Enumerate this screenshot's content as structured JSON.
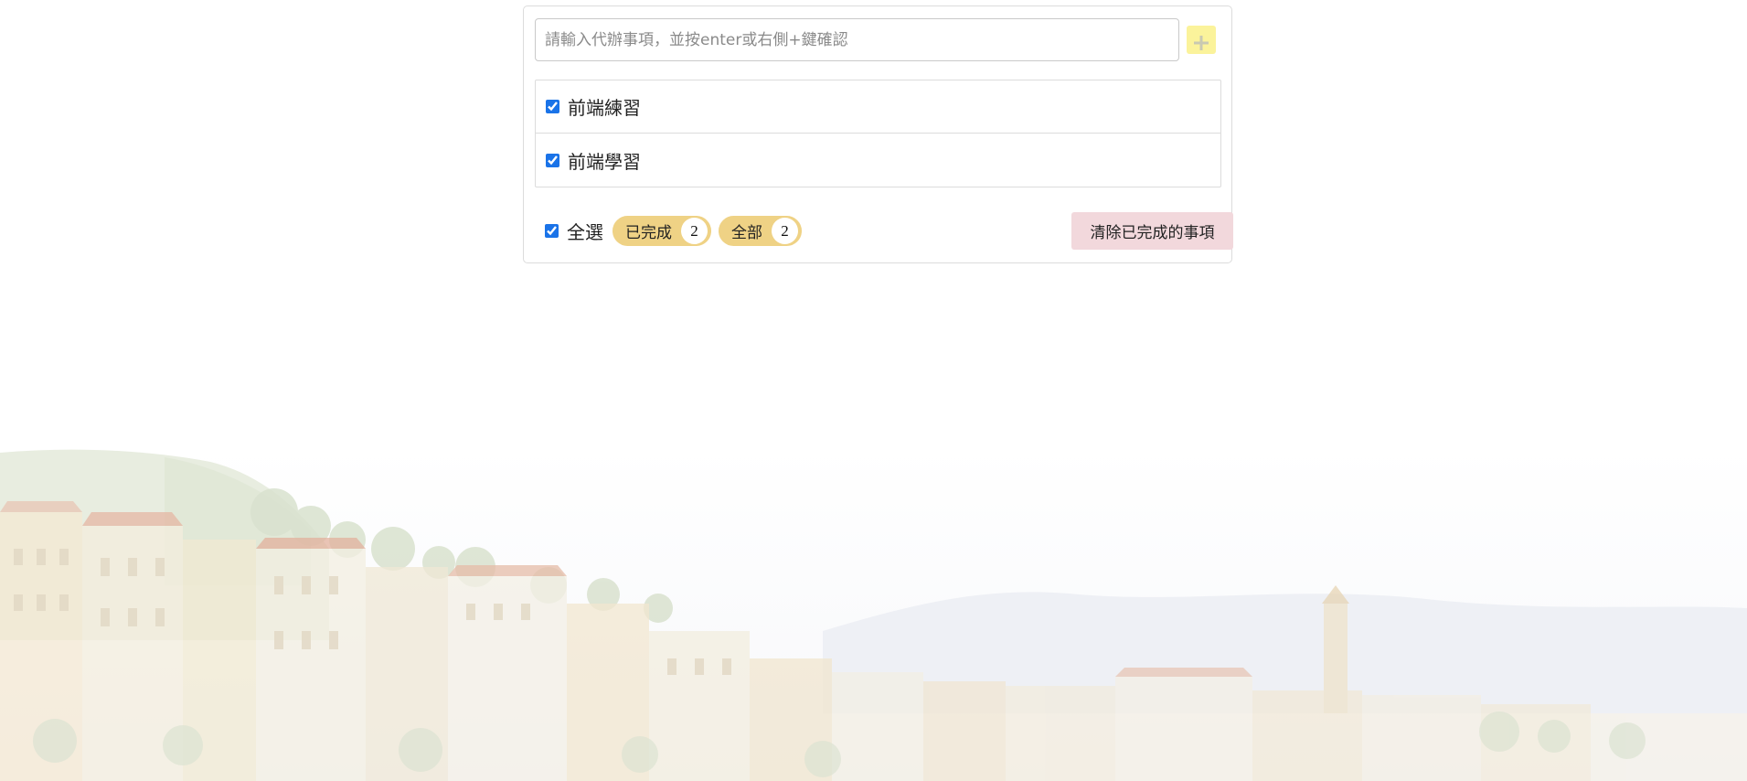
{
  "input": {
    "placeholder": "請輸入代辦事項，並按enter或右側+鍵確認",
    "value": ""
  },
  "add_button": {
    "icon": "plus-icon"
  },
  "todos": [
    {
      "label": "前端練習",
      "checked": true
    },
    {
      "label": "前端學習",
      "checked": true
    }
  ],
  "footer": {
    "select_all_label": "全選",
    "select_all_checked": true,
    "completed_filter": {
      "label": "已完成",
      "count": "2"
    },
    "all_filter": {
      "label": "全部",
      "count": "2"
    },
    "clear_completed_label": "清除已完成的事項"
  },
  "colors": {
    "add_button": "#fbf39b",
    "filter_pill": "#efd285",
    "clear_button": "#f2d8dc",
    "checkbox_accent": "#1a73e8"
  }
}
